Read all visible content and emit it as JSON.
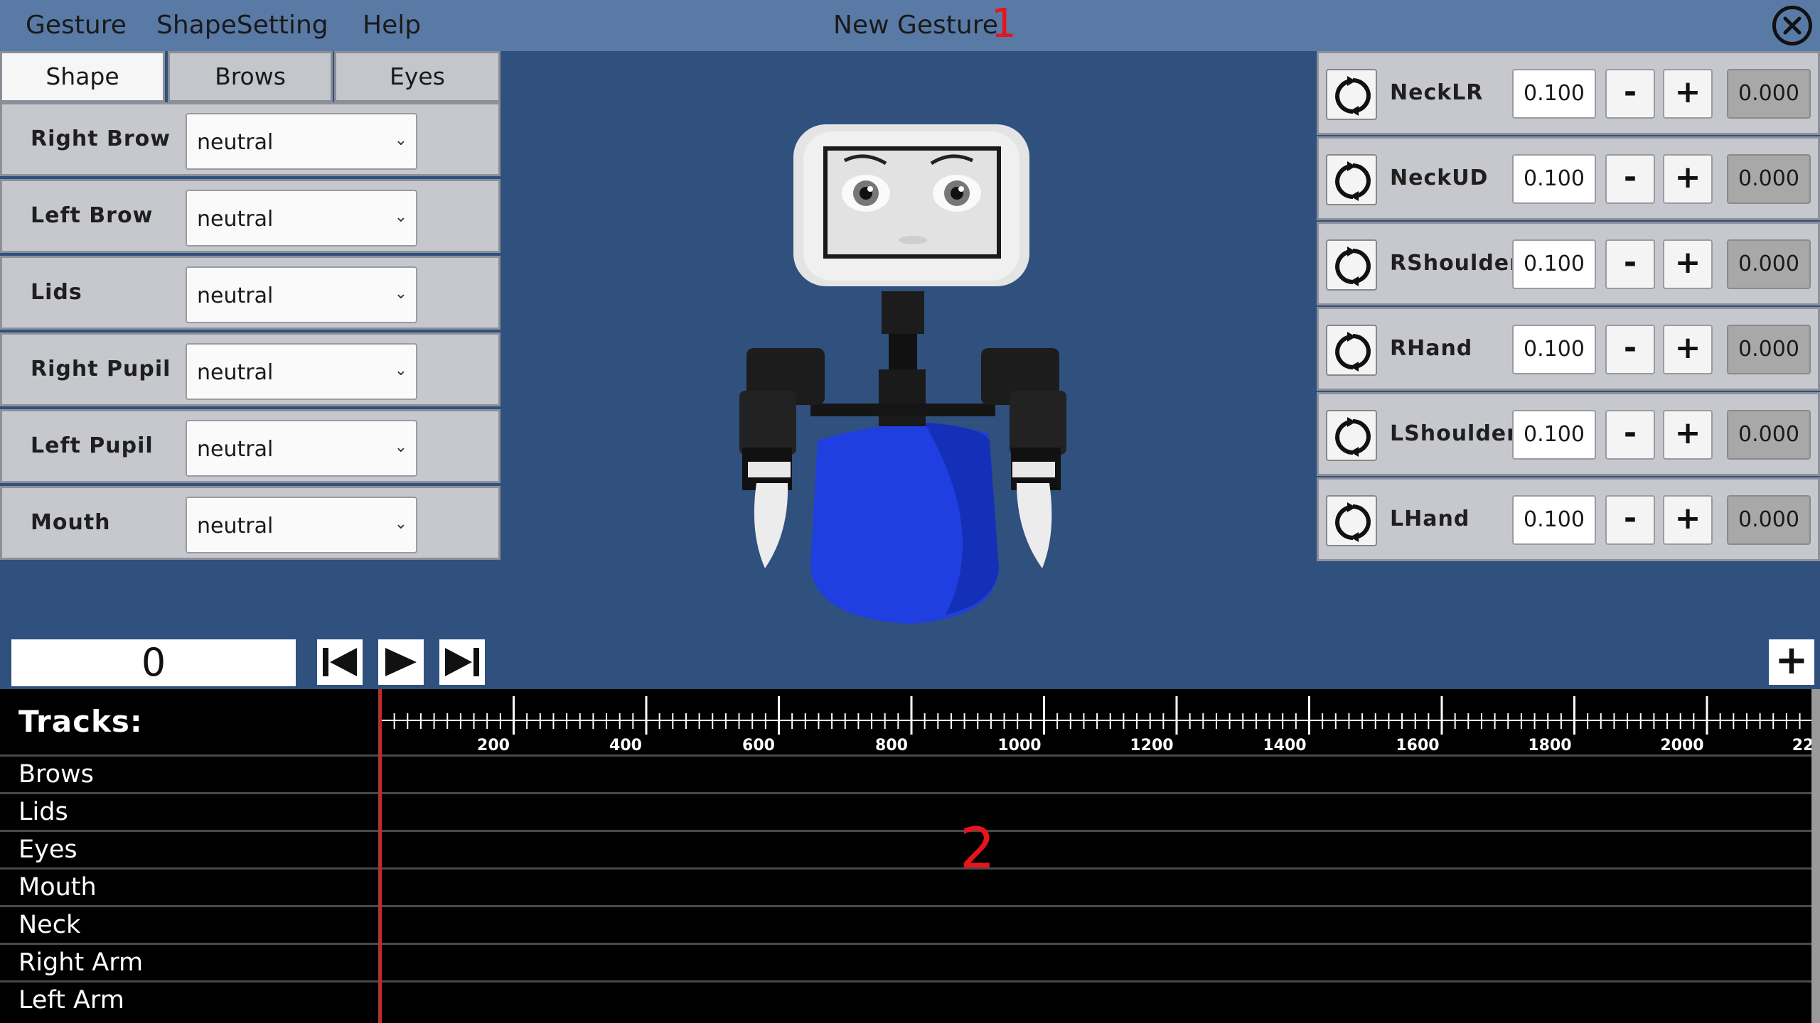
{
  "menubar": {
    "items": [
      "Gesture",
      "ShapeSetting",
      "Help"
    ],
    "title": "New Gesture",
    "annotation": "1"
  },
  "left_panel": {
    "tabs": [
      {
        "label": "Shape",
        "active": true
      },
      {
        "label": "Brows",
        "active": false
      },
      {
        "label": "Eyes",
        "active": false
      }
    ],
    "rows": [
      {
        "label": "Right Brow",
        "value": "neutral"
      },
      {
        "label": "Left Brow",
        "value": "neutral"
      },
      {
        "label": "Lids",
        "value": "neutral"
      },
      {
        "label": "Right Pupil",
        "value": "neutral"
      },
      {
        "label": "Left Pupil",
        "value": "neutral"
      },
      {
        "label": "Mouth",
        "value": "neutral"
      }
    ]
  },
  "right_panel": {
    "joints": [
      {
        "label": "NeckLR",
        "step": "0.100",
        "value": "0.000",
        "minus": "-",
        "plus": "+"
      },
      {
        "label": "NeckUD",
        "step": "0.100",
        "value": "0.000",
        "minus": "-",
        "plus": "+"
      },
      {
        "label": "RShoulder",
        "step": "0.100",
        "value": "0.000",
        "minus": "-",
        "plus": "+"
      },
      {
        "label": "RHand",
        "step": "0.100",
        "value": "0.000",
        "minus": "-",
        "plus": "+"
      },
      {
        "label": "LShoulder",
        "step": "0.100",
        "value": "0.000",
        "minus": "-",
        "plus": "+"
      },
      {
        "label": "LHand",
        "step": "0.100",
        "value": "0.000",
        "minus": "-",
        "plus": "+"
      }
    ]
  },
  "playback": {
    "frame": "0",
    "add_label": "+",
    "icons": [
      "skip-start-icon",
      "play-icon",
      "skip-end-icon"
    ]
  },
  "tracks": {
    "header": "Tracks:",
    "ruler_labels": [
      "200",
      "400",
      "600",
      "800",
      "1000",
      "1200",
      "1400",
      "1600",
      "1800",
      "2000",
      "22"
    ],
    "rows": [
      "Brows",
      "Lids",
      "Eyes",
      "Mouth",
      "Neck",
      "Right Arm",
      "Left Arm"
    ],
    "annotation": "2"
  },
  "colors": {
    "background": "#30507e",
    "menubar": "#5a7aa6",
    "panel": "#c6c8ce",
    "annotation": "#e8141b",
    "playhead": "#d42222",
    "robot_body": "#1f3fe0"
  }
}
